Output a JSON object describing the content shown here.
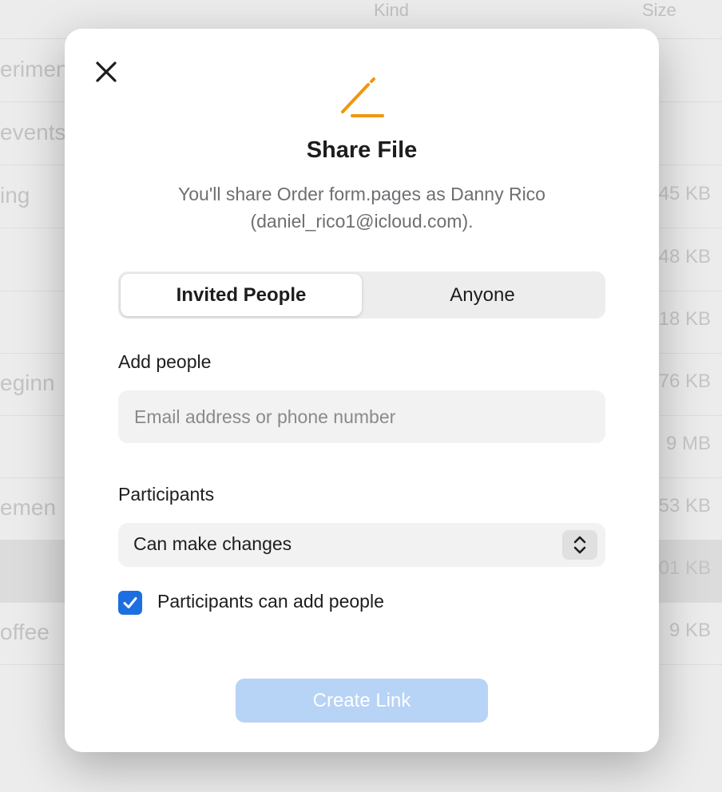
{
  "background": {
    "columns": {
      "kind": "Kind",
      "size": "Size"
    },
    "rows": [
      {
        "name": "erimen",
        "size": ""
      },
      {
        "name": "events",
        "size": ""
      },
      {
        "name": "ing",
        "size": "45 KB"
      },
      {
        "name": "",
        "size": "48 KB"
      },
      {
        "name": "",
        "size": "18 KB"
      },
      {
        "name": "eginn",
        "size": "76 KB"
      },
      {
        "name": "",
        "size": "9 MB"
      },
      {
        "name": "emen",
        "size": "53 KB"
      },
      {
        "name": "",
        "size": "01 KB"
      },
      {
        "name": "offee",
        "size": "9 KB"
      }
    ]
  },
  "dialog": {
    "title": "Share File",
    "description": "You'll share Order form.pages as Danny Rico (daniel_rico1@icloud.com).",
    "icon": "pencil-icon",
    "accent_color": "#f0960e",
    "segments": {
      "active": "Invited People",
      "inactive": "Anyone"
    },
    "add_people": {
      "label": "Add people",
      "placeholder": "Email address or phone number",
      "value": ""
    },
    "participants": {
      "label": "Participants",
      "selected": "Can make changes"
    },
    "checkbox": {
      "label": "Participants can add people",
      "checked": true,
      "color": "#1c6fe0"
    },
    "create_button": "Create Link"
  }
}
